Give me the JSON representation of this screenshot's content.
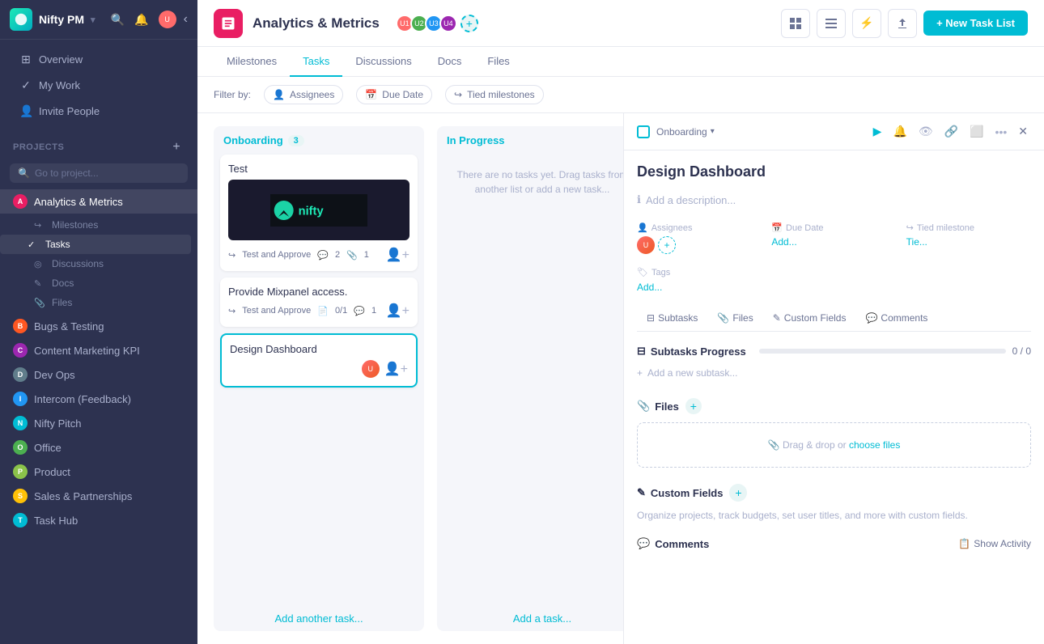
{
  "app": {
    "name": "Nifty PM",
    "logo_label": "N"
  },
  "sidebar": {
    "nav_items": [
      {
        "id": "overview",
        "label": "Overview",
        "icon": "⊞"
      },
      {
        "id": "my-work",
        "label": "My Work",
        "icon": "✓"
      },
      {
        "id": "invite",
        "label": "Invite People",
        "icon": "👤+"
      }
    ],
    "projects_label": "PROJECTS",
    "search_placeholder": "Go to project...",
    "add_project_label": "+",
    "projects": [
      {
        "id": "analytics",
        "label": "Analytics & Metrics",
        "color": "#e91e63",
        "active": true
      },
      {
        "id": "bugs",
        "label": "Bugs & Testing",
        "color": "#ff5722"
      },
      {
        "id": "content",
        "label": "Content Marketing KPI",
        "color": "#9c27b0"
      },
      {
        "id": "devops",
        "label": "Dev Ops",
        "color": "#607d8b"
      },
      {
        "id": "intercom",
        "label": "Intercom (Feedback)",
        "color": "#2196f3"
      },
      {
        "id": "pitch",
        "label": "Nifty Pitch",
        "color": "#00bcd4"
      },
      {
        "id": "office",
        "label": "Office",
        "color": "#4caf50"
      },
      {
        "id": "product",
        "label": "Product",
        "color": "#8bc34a"
      },
      {
        "id": "sales",
        "label": "Sales & Partnerships",
        "color": "#ffc107"
      },
      {
        "id": "task-hub",
        "label": "Task Hub",
        "color": "#00bcd4"
      }
    ],
    "analytics_children": [
      {
        "id": "milestones",
        "label": "Milestones",
        "icon": "↪"
      },
      {
        "id": "tasks",
        "label": "Tasks",
        "icon": "✓",
        "active": true
      },
      {
        "id": "discussions",
        "label": "Discussions",
        "icon": "◎"
      },
      {
        "id": "docs",
        "label": "Docs",
        "icon": "✎"
      },
      {
        "id": "files",
        "label": "Files",
        "icon": "📎"
      }
    ]
  },
  "topbar": {
    "project_name": "Analytics & Metrics",
    "new_task_list_label": "+ New Task List"
  },
  "nav_tabs": [
    {
      "id": "milestones",
      "label": "Milestones"
    },
    {
      "id": "tasks",
      "label": "Tasks",
      "active": true
    },
    {
      "id": "discussions",
      "label": "Discussions"
    },
    {
      "id": "docs",
      "label": "Docs"
    },
    {
      "id": "files",
      "label": "Files"
    }
  ],
  "filter_bar": {
    "filter_by_label": "Filter by:",
    "filters": [
      {
        "id": "assignees",
        "label": "Assignees",
        "icon": "👤"
      },
      {
        "id": "due-date",
        "label": "Due Date",
        "icon": "📅"
      },
      {
        "id": "tied-milestones",
        "label": "Tied milestones",
        "icon": "↪"
      }
    ]
  },
  "columns": [
    {
      "id": "onboarding",
      "title": "Onboarding",
      "count": 3,
      "cards": [
        {
          "id": "test",
          "title": "Test",
          "has_image": true,
          "meta_label": "Test and Approve",
          "comments": 2,
          "attachments": 1
        },
        {
          "id": "mixpanel",
          "title": "Provide  Mixpanel access.",
          "meta_label": "Test and Approve",
          "docs": "0/1",
          "comments": 1
        },
        {
          "id": "design-dashboard",
          "title": "Design Dashboard",
          "selected": true
        }
      ],
      "add_task_label": "Add another task..."
    },
    {
      "id": "in-progress",
      "title": "In Progress",
      "count": null,
      "empty_message": "There are no tasks yet. Drag tasks from another list or add a new task...",
      "add_task_label": "Add a task..."
    }
  ],
  "task_detail": {
    "task_list_name": "Onboarding",
    "task_title": "Design Dashboard",
    "add_description_label": "Add a description...",
    "fields": {
      "assignees_label": "Assignees",
      "due_date_label": "Due Date",
      "due_date_value": "Add...",
      "tied_milestone_label": "Tied milestone",
      "tied_milestone_value": "Tie...",
      "tags_label": "Tags",
      "tags_add": "Add..."
    },
    "tabs": [
      {
        "id": "subtasks",
        "label": "Subtasks",
        "icon": "⊟"
      },
      {
        "id": "files",
        "label": "Files",
        "icon": "📎"
      },
      {
        "id": "custom-fields",
        "label": "Custom Fields",
        "icon": "✎"
      },
      {
        "id": "comments",
        "label": "Comments",
        "icon": "💬"
      }
    ],
    "subtasks": {
      "title": "Subtasks Progress",
      "progress": "0 / 0",
      "progress_pct": 0,
      "add_label": "Add a new subtask..."
    },
    "files": {
      "title": "Files",
      "drop_label": "Drag & drop or ",
      "choose_label": "choose files"
    },
    "custom_fields": {
      "title": "Custom Fields",
      "description": "Organize projects, track budgets, set user titles, and more with custom fields."
    },
    "comments": {
      "title": "Comments",
      "show_activity_label": "Show Activity"
    }
  }
}
